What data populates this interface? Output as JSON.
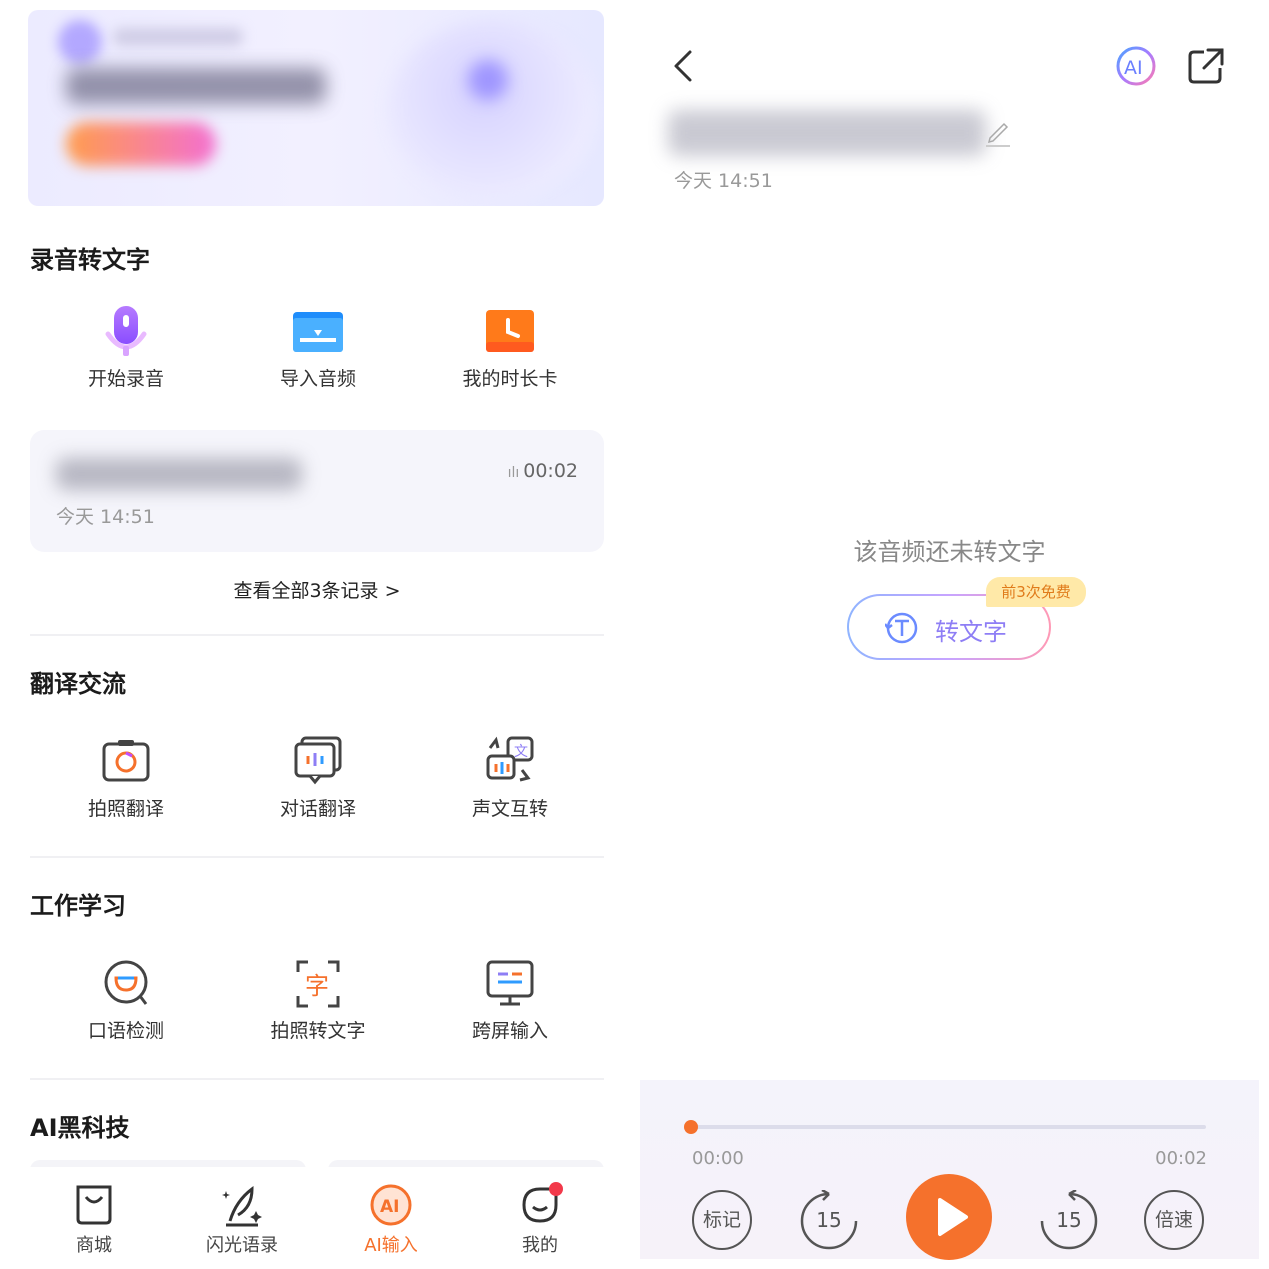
{
  "left": {
    "section_recording": {
      "title": "录音转文字",
      "items": [
        {
          "label": "开始录音",
          "icon": "microphone-icon"
        },
        {
          "label": "导入音频",
          "icon": "folder-icon"
        },
        {
          "label": "我的时长卡",
          "icon": "clock-card-icon"
        }
      ],
      "recent": {
        "duration": "00:02",
        "time": "今天 14:51"
      },
      "view_all": "查看全部3条记录 >"
    },
    "section_translate": {
      "title": "翻译交流",
      "items": [
        {
          "label": "拍照翻译",
          "icon": "camera-translate-icon"
        },
        {
          "label": "对话翻译",
          "icon": "dialogue-translate-icon"
        },
        {
          "label": "声文互转",
          "icon": "voice-text-convert-icon"
        }
      ]
    },
    "section_work": {
      "title": "工作学习",
      "items": [
        {
          "label": "口语检测",
          "icon": "speaking-check-icon"
        },
        {
          "label": "拍照转文字",
          "icon": "photo-to-text-icon"
        },
        {
          "label": "跨屏输入",
          "icon": "cross-screen-icon"
        }
      ]
    },
    "section_ai": {
      "title": "AI黑科技"
    },
    "tabbar": [
      {
        "label": "商城",
        "icon": "shop-bag-icon"
      },
      {
        "label": "闪光语录",
        "icon": "quill-sparkle-icon"
      },
      {
        "label": "AI输入",
        "icon": "ai-input-icon"
      },
      {
        "label": "我的",
        "icon": "profile-face-icon"
      }
    ]
  },
  "right": {
    "time": "今天 14:51",
    "empty_message": "该音频还未转文字",
    "transcribe_label": "转文字",
    "free_badge": "前3次免费",
    "player": {
      "start": "00:00",
      "end": "00:02",
      "progress": 0,
      "mark_label": "标记",
      "rewind_label": "15",
      "forward_label": "15",
      "speed_label": "倍速"
    }
  },
  "colors": {
    "accent": "#f5712c",
    "purple": "#8e7ef5",
    "notification": "#f2394a"
  }
}
